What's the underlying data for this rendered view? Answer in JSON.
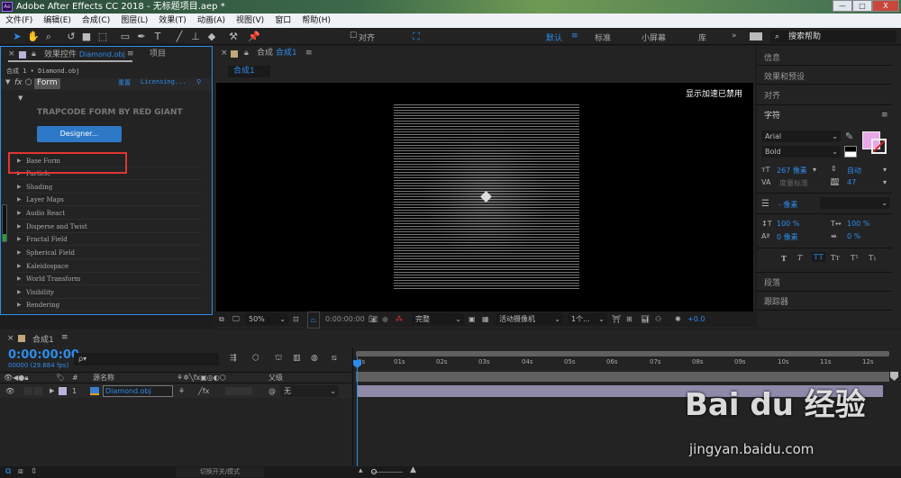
{
  "title": "Adobe After Effects CC 2018 - 无标题项目.aep *",
  "app_badge": "Ae",
  "window_buttons": [
    "—",
    "□",
    "X"
  ],
  "menu": [
    "文件(F)",
    "编辑(E)",
    "合成(C)",
    "图层(L)",
    "效果(T)",
    "动画(A)",
    "视图(V)",
    "窗口",
    "帮助(H)"
  ],
  "toolbar": {
    "align_label": "对齐",
    "workspaces": [
      "默认",
      "标准",
      "小屏幕",
      "库"
    ],
    "more": "»",
    "search_placeholder": "搜索帮助"
  },
  "effects_panel": {
    "tab_label": "效果控件",
    "tab_layer": "Diamond.obj",
    "project_tab": "项目",
    "breadcrumb": "合成 1 • Diamond.obj",
    "effect_name": "Form",
    "reset": "重置",
    "licensing": "Licensing...",
    "plugin_title": "TRAPCODE FORM BY RED GIANT",
    "designer_button": "Designer...",
    "groups": [
      "Base Form",
      "Particle",
      "Shading",
      "Layer Maps",
      "Audio React",
      "Disperse and Twist",
      "Fractal Field",
      "Spherical Field",
      "Kaleidospace",
      "World Transform",
      "Visibility",
      "Rendering"
    ]
  },
  "comp_panel": {
    "tab_prefix": "合成",
    "tab_name": "合成1",
    "subtab": "合成1",
    "gpu_notice": "显示加速已禁用",
    "zoom": "50%",
    "timecode": "0:00:00:00",
    "resolution": "完整",
    "camera": "活动摄像机",
    "views": "1个...",
    "exposure": "+0.0"
  },
  "right_panel": {
    "info": "信息",
    "effects_presets": "效果和预设",
    "align": "对齐",
    "character": "字符",
    "font": "Arial",
    "style": "Bold",
    "fill_color": "#e8a8e8",
    "font_size": "267 像素",
    "leading": "自动",
    "kerning": "度量标准",
    "tracking": "47",
    "stroke_width": "- 像素",
    "vscale": "100 %",
    "hscale": "100 %",
    "baseline": "0 像素",
    "tsume": "0 %",
    "type_buttons": [
      "T",
      "T",
      "TT",
      "Tт",
      "T¹",
      "T₁"
    ],
    "paragraph": "段落",
    "tracker": "跟踪器"
  },
  "timeline": {
    "tab": "合成1",
    "timecode": "0:00:00:00",
    "fps": "00000 (29.684 fps)",
    "search_placeholder": "ρ▾",
    "col_source": "源名称",
    "col_num": "#",
    "col_parent": "父级",
    "layer": {
      "index": "1",
      "name": "Diamond.obj",
      "parent": "无"
    },
    "ticks": [
      "0s",
      "01s",
      "02s",
      "03s",
      "04s",
      "05s",
      "06s",
      "07s",
      "08s",
      "09s",
      "10s",
      "11s",
      "12s"
    ]
  },
  "bottom": {
    "toggle": "切换开关/模式"
  },
  "watermark": {
    "logo": "Bai du 经验",
    "url": "jingyan.baidu.com"
  }
}
